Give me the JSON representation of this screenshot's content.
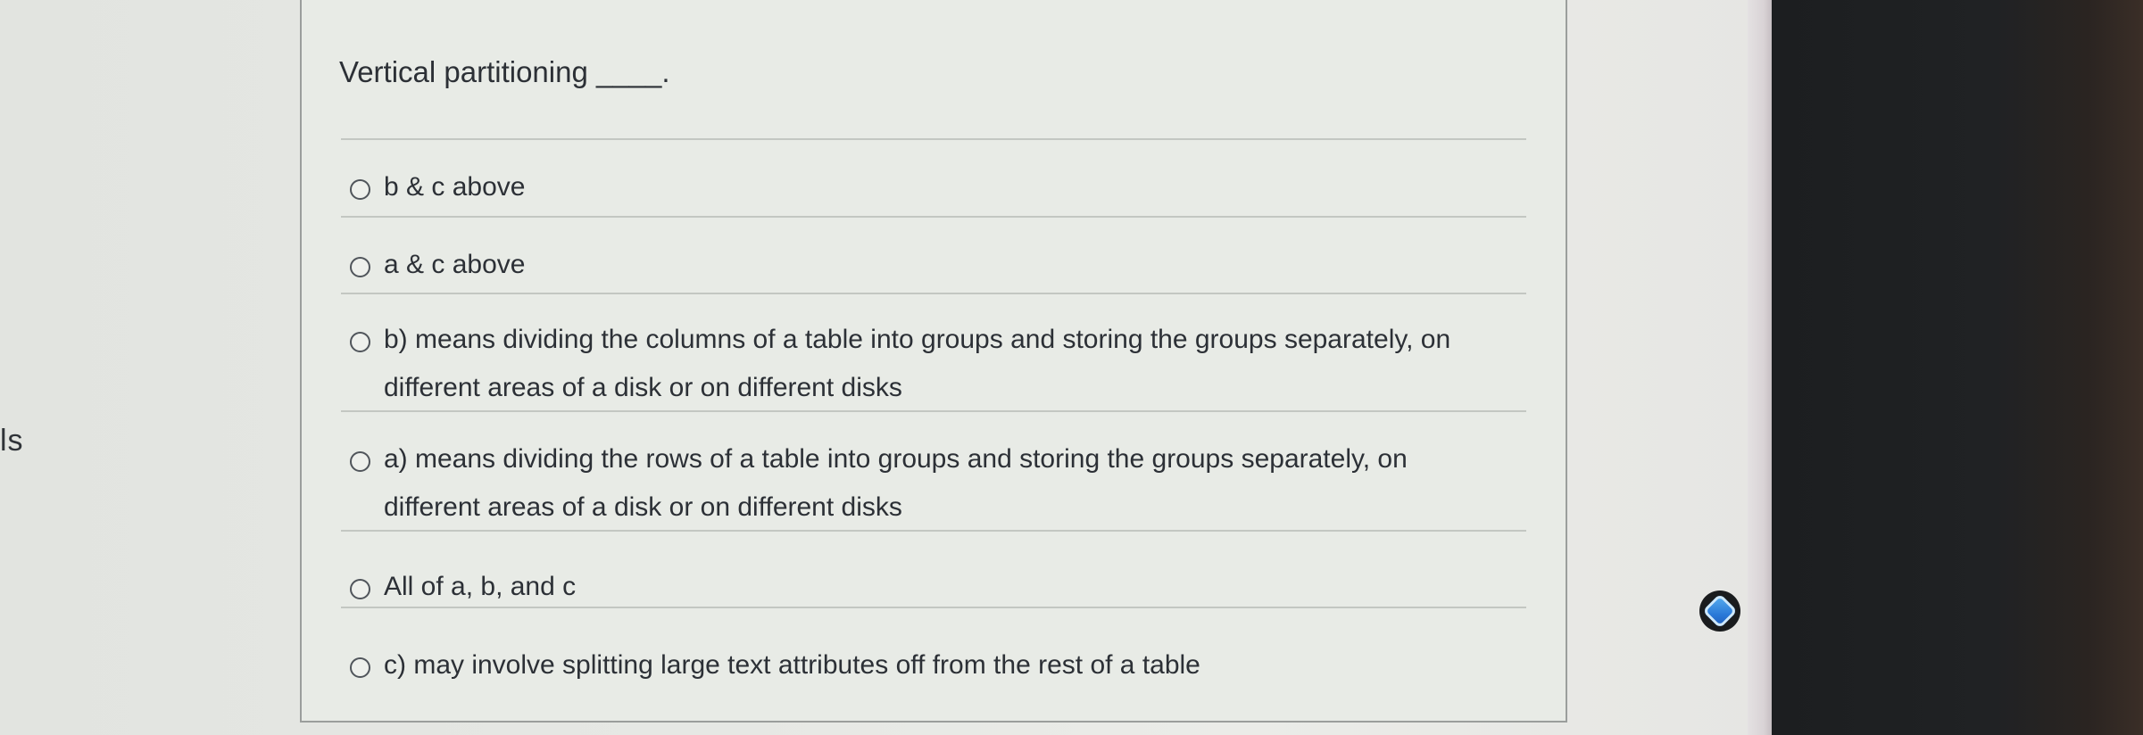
{
  "side_label": "ls",
  "quiz": {
    "question": "Vertical partitioning ____.",
    "options": [
      {
        "label": "b & c above"
      },
      {
        "label": "a & c above"
      },
      {
        "label": "b) means dividing the columns of a table into groups and storing the groups separately, on different areas of a disk or on different disks"
      },
      {
        "label": "a) means dividing the rows of a table into groups and storing the groups separately, on different areas of a disk or on different disks"
      },
      {
        "label": "All of a, b, and c"
      },
      {
        "label": "c) may involve splitting large text attributes off from the rest of a table"
      }
    ]
  },
  "assistant_icon": "diamond-assistant-icon",
  "colors": {
    "card_background": "#e8ebe6",
    "text": "#2c3036",
    "bezel": "#1c1e20"
  }
}
